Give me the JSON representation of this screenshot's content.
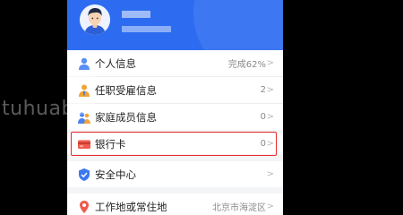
{
  "watermark": "tuhuaba.com",
  "profile": {
    "name": "",
    "phone": ""
  },
  "menu": [
    {
      "id": "personal-info",
      "label": "个人信息",
      "value": "完成62%",
      "icon": "person-icon"
    },
    {
      "id": "employment-info",
      "label": "任职受雇信息",
      "value": "2",
      "icon": "employer-icon"
    },
    {
      "id": "family-members",
      "label": "家庭成员信息",
      "value": "0",
      "icon": "family-icon"
    },
    {
      "id": "bank-card",
      "label": "银行卡",
      "value": "0",
      "icon": "bank-card-icon"
    },
    {
      "id": "security-center",
      "label": "安全中心",
      "value": "",
      "icon": "shield-icon"
    },
    {
      "id": "work-residence",
      "label": "工作地或常住地",
      "value": "北京市海淀区",
      "icon": "location-pin-icon"
    }
  ],
  "colors": {
    "accent": "#2d6cf0",
    "highlight": "#e8282c",
    "background": "#000000"
  }
}
